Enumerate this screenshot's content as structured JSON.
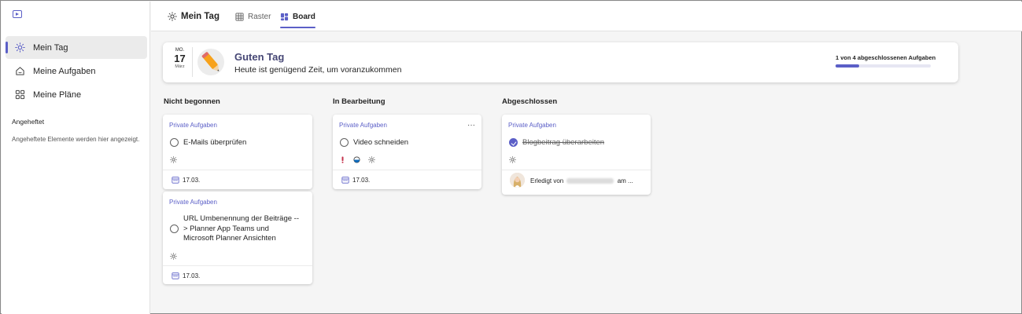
{
  "sidebar": {
    "items": [
      {
        "label": "Mein Tag",
        "icon": "sun-icon",
        "active": true
      },
      {
        "label": "Meine Aufgaben",
        "icon": "home-icon",
        "active": false
      },
      {
        "label": "Meine Pläne",
        "icon": "grid-icon",
        "active": false
      }
    ],
    "pinned_heading": "Angeheftet",
    "pinned_note": "Angeheftete Elemente werden hier angezeigt."
  },
  "header": {
    "title": "Mein Tag",
    "tabs": [
      {
        "label": "Raster",
        "icon": "table-icon",
        "active": false
      },
      {
        "label": "Board",
        "icon": "board-icon",
        "active": true
      }
    ]
  },
  "greeting": {
    "weekday": "MO.",
    "day": "17",
    "month": "März",
    "title": "Guten Tag",
    "subtitle": "Heute ist genügend Zeit, um voranzukommen",
    "progress_label": "1 von 4 abgeschlossenen Aufgaben",
    "progress_fraction": 0.25
  },
  "columns": [
    {
      "title": "Nicht begonnen"
    },
    {
      "title": "In Bearbeitung"
    },
    {
      "title": "Abgeschlossen"
    }
  ],
  "cards": {
    "c1": {
      "plan": "Private Aufgaben",
      "title": "E-Mails überprüfen",
      "date": "17.03."
    },
    "c2": {
      "plan": "Private Aufgaben",
      "title": "URL Umbenennung der Beiträge --> Planner App Teams und Microsoft Planner Ansichten",
      "date": "17.03."
    },
    "c3": {
      "plan": "Private Aufgaben",
      "title": "Video schneiden",
      "date": "17.03.",
      "more": "···"
    },
    "c4": {
      "plan": "Private Aufgaben",
      "title": "Blogbeitrag überarbeiten",
      "done_prefix": "Erledigt von",
      "done_suffix": "am ..."
    }
  },
  "colors": {
    "accent": "#5b5fc7",
    "urgent": "#c4314b",
    "greeting_title": "#464775"
  }
}
